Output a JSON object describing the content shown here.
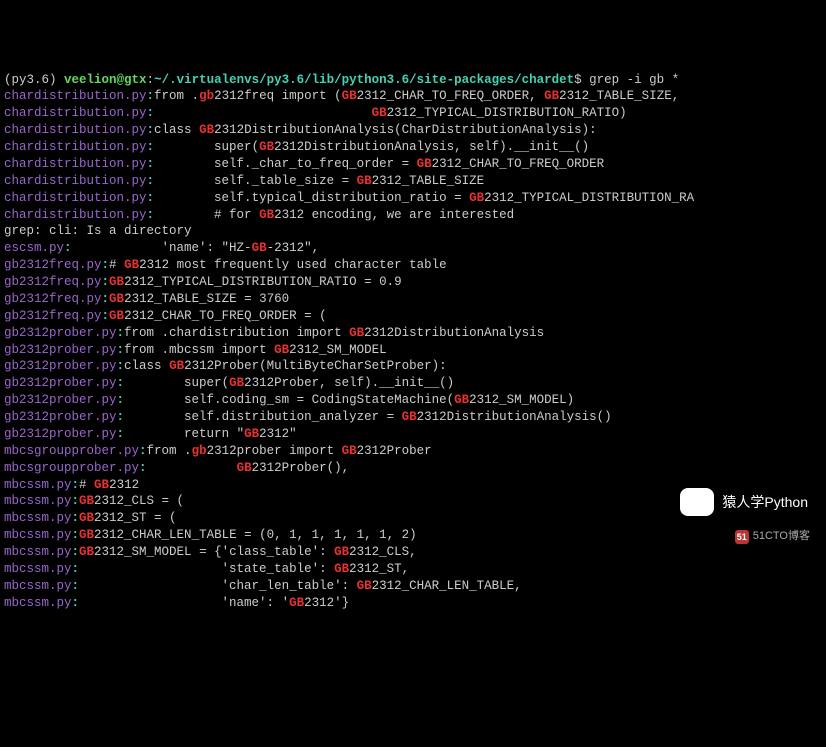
{
  "prompt": {
    "venv": "(py3.6)",
    "user_host": "veelion@gtx",
    "sep": ":",
    "cwd": "~/.virtualenvs/py3.6/lib/python3.6/site-packages/chardet",
    "dollar": "$",
    "cmd_pre": " grep -i gb *"
  },
  "lines": [
    {
      "file": "chardistribution.py",
      "c": ":",
      "s": [
        [
          "w",
          "from ."
        ],
        [
          "r",
          "gb"
        ],
        [
          "w",
          "2312freq import ("
        ],
        [
          "r",
          "GB"
        ],
        [
          "w",
          "2312_CHAR_TO_FREQ_ORDER, "
        ],
        [
          "r",
          "GB"
        ],
        [
          "w",
          "2312_TABLE_SIZE,"
        ]
      ]
    },
    {
      "file": "chardistribution.py",
      "c": ":",
      "s": [
        [
          "w",
          "                             "
        ],
        [
          "r",
          "GB"
        ],
        [
          "w",
          "2312_TYPICAL_DISTRIBUTION_RATIO)"
        ]
      ]
    },
    {
      "file": "chardistribution.py",
      "c": ":",
      "s": [
        [
          "w",
          "class "
        ],
        [
          "r",
          "GB"
        ],
        [
          "w",
          "2312DistributionAnalysis(CharDistributionAnalysis):"
        ]
      ]
    },
    {
      "file": "chardistribution.py",
      "c": ":",
      "s": [
        [
          "w",
          "        super("
        ],
        [
          "r",
          "GB"
        ],
        [
          "w",
          "2312DistributionAnalysis, self).__init__()"
        ]
      ]
    },
    {
      "file": "chardistribution.py",
      "c": ":",
      "s": [
        [
          "w",
          "        self._char_to_freq_order = "
        ],
        [
          "r",
          "GB"
        ],
        [
          "w",
          "2312_CHAR_TO_FREQ_ORDER"
        ]
      ]
    },
    {
      "file": "chardistribution.py",
      "c": ":",
      "s": [
        [
          "w",
          "        self._table_size = "
        ],
        [
          "r",
          "GB"
        ],
        [
          "w",
          "2312_TABLE_SIZE"
        ]
      ]
    },
    {
      "file": "chardistribution.py",
      "c": ":",
      "s": [
        [
          "w",
          "        self.typical_distribution_ratio = "
        ],
        [
          "r",
          "GB"
        ],
        [
          "w",
          "2312_TYPICAL_DISTRIBUTION_RA"
        ]
      ]
    },
    {
      "file": "chardistribution.py",
      "c": ":",
      "s": [
        [
          "w",
          "        # for "
        ],
        [
          "r",
          "GB"
        ],
        [
          "w",
          "2312 encoding, we are interested"
        ]
      ]
    },
    {
      "plain": "grep: cli: Is a directory"
    },
    {
      "file": "escsm.py",
      "c": ":",
      "s": [
        [
          "w",
          "            'name': \"HZ-"
        ],
        [
          "r",
          "GB"
        ],
        [
          "w",
          "-2312\","
        ]
      ]
    },
    {
      "file": "gb2312freq.py",
      "c": ":",
      "s": [
        [
          "w",
          "# "
        ],
        [
          "r",
          "GB"
        ],
        [
          "w",
          "2312 most frequently used character table"
        ]
      ]
    },
    {
      "file": "gb2312freq.py",
      "c": ":",
      "s": [
        [
          "r",
          "GB"
        ],
        [
          "w",
          "2312_TYPICAL_DISTRIBUTION_RATIO = 0.9"
        ]
      ]
    },
    {
      "file": "gb2312freq.py",
      "c": ":",
      "s": [
        [
          "r",
          "GB"
        ],
        [
          "w",
          "2312_TABLE_SIZE = 3760"
        ]
      ]
    },
    {
      "file": "gb2312freq.py",
      "c": ":",
      "s": [
        [
          "r",
          "GB"
        ],
        [
          "w",
          "2312_CHAR_TO_FREQ_ORDER = ("
        ]
      ]
    },
    {
      "file": "gb2312prober.py",
      "c": ":",
      "s": [
        [
          "w",
          "from .chardistribution import "
        ],
        [
          "r",
          "GB"
        ],
        [
          "w",
          "2312DistributionAnalysis"
        ]
      ]
    },
    {
      "file": "gb2312prober.py",
      "c": ":",
      "s": [
        [
          "w",
          "from .mbcssm import "
        ],
        [
          "r",
          "GB"
        ],
        [
          "w",
          "2312_SM_MODEL"
        ]
      ]
    },
    {
      "file": "gb2312prober.py",
      "c": ":",
      "s": [
        [
          "w",
          "class "
        ],
        [
          "r",
          "GB"
        ],
        [
          "w",
          "2312Prober(MultiByteCharSetProber):"
        ]
      ]
    },
    {
      "file": "gb2312prober.py",
      "c": ":",
      "s": [
        [
          "w",
          "        super("
        ],
        [
          "r",
          "GB"
        ],
        [
          "w",
          "2312Prober, self).__init__()"
        ]
      ]
    },
    {
      "file": "gb2312prober.py",
      "c": ":",
      "s": [
        [
          "w",
          "        self.coding_sm = CodingStateMachine("
        ],
        [
          "r",
          "GB"
        ],
        [
          "w",
          "2312_SM_MODEL)"
        ]
      ]
    },
    {
      "file": "gb2312prober.py",
      "c": ":",
      "s": [
        [
          "w",
          "        self.distribution_analyzer = "
        ],
        [
          "r",
          "GB"
        ],
        [
          "w",
          "2312DistributionAnalysis()"
        ]
      ]
    },
    {
      "file": "gb2312prober.py",
      "c": ":",
      "s": [
        [
          "w",
          "        return \""
        ],
        [
          "r",
          "GB"
        ],
        [
          "w",
          "2312\""
        ]
      ]
    },
    {
      "file": "mbcsgroupprober.py",
      "c": ":",
      "s": [
        [
          "w",
          "from ."
        ],
        [
          "r",
          "gb"
        ],
        [
          "w",
          "2312prober import "
        ],
        [
          "r",
          "GB"
        ],
        [
          "w",
          "2312Prober"
        ]
      ]
    },
    {
      "file": "mbcsgroupprober.py",
      "c": ":",
      "s": [
        [
          "w",
          "            "
        ],
        [
          "r",
          "GB"
        ],
        [
          "w",
          "2312Prober(),"
        ]
      ]
    },
    {
      "file": "mbcssm.py",
      "c": ":",
      "s": [
        [
          "w",
          "# "
        ],
        [
          "r",
          "GB"
        ],
        [
          "w",
          "2312"
        ]
      ]
    },
    {
      "file": "mbcssm.py",
      "c": ":",
      "s": [
        [
          "r",
          "GB"
        ],
        [
          "w",
          "2312_CLS = ("
        ]
      ]
    },
    {
      "file": "mbcssm.py",
      "c": ":",
      "s": [
        [
          "r",
          "GB"
        ],
        [
          "w",
          "2312_ST = ("
        ]
      ]
    },
    {
      "file": "mbcssm.py",
      "c": ":",
      "s": [
        [
          "r",
          "GB"
        ],
        [
          "w",
          "2312_CHAR_LEN_TABLE = (0, 1, 1, 1, 1, 1, 2)"
        ]
      ]
    },
    {
      "file": "mbcssm.py",
      "c": ":",
      "s": [
        [
          "r",
          "GB"
        ],
        [
          "w",
          "2312_SM_MODEL = {'class_table': "
        ],
        [
          "r",
          "GB"
        ],
        [
          "w",
          "2312_CLS,"
        ]
      ]
    },
    {
      "file": "mbcssm.py",
      "c": ":",
      "s": [
        [
          "w",
          "                   'state_table': "
        ],
        [
          "r",
          "GB"
        ],
        [
          "w",
          "2312_ST,"
        ]
      ]
    },
    {
      "file": "mbcssm.py",
      "c": ":",
      "s": [
        [
          "w",
          "                   'char_len_table': "
        ],
        [
          "r",
          "GB"
        ],
        [
          "w",
          "2312_CHAR_LEN_TABLE,"
        ]
      ]
    },
    {
      "file": "mbcssm.py",
      "c": ":",
      "s": [
        [
          "w",
          "                   'name': '"
        ],
        [
          "r",
          "GB"
        ],
        [
          "w",
          "2312'}"
        ]
      ]
    }
  ],
  "watermark": "猿人学Python",
  "blogmark": "51CTO博客"
}
